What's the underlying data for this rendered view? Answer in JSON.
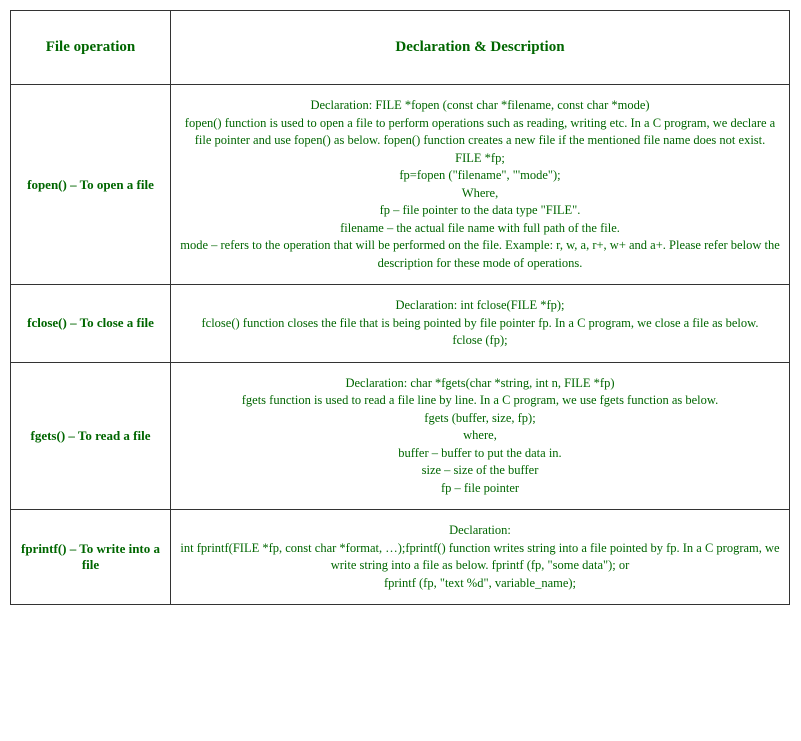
{
  "headers": {
    "col1": "File operation",
    "col2": "Declaration & Description"
  },
  "rows": [
    {
      "operation": "fopen() – To open a file",
      "lines": [
        "Declaration: FILE *fopen (const char *filename, const char *mode)",
        "fopen() function is used to open a file to perform operations such as reading, writing etc. In a C program, we declare a file pointer and use fopen() as below. fopen() function creates a new file if the mentioned file name does not exist.",
        "FILE *fp;",
        "fp=fopen (\"filename\", \"'mode\");",
        "Where,",
        "fp – file pointer to the data type \"FILE\".",
        "filename – the actual file name with full path of the file.",
        "mode – refers to the operation that will be performed on the file. Example: r, w, a, r+, w+ and a+. Please refer below the description for these mode of operations."
      ]
    },
    {
      "operation": "fclose() – To close a file",
      "lines": [
        "Declaration: int fclose(FILE *fp);",
        "fclose() function closes the file that is being pointed by file pointer fp. In a C program, we close a file as below.",
        "fclose (fp);"
      ]
    },
    {
      "operation": "fgets() – To read a file",
      "lines": [
        "Declaration: char *fgets(char *string, int n, FILE *fp)",
        "fgets function is used to read a file line by line. In a C program, we use fgets function as below.",
        "fgets (buffer, size, fp);",
        "where,",
        "buffer – buffer to put the data in.",
        "size – size of the buffer",
        "fp – file pointer"
      ]
    },
    {
      "operation": "fprintf() – To write into a file",
      "lines": [
        "Declaration:",
        "int fprintf(FILE *fp, const char *format, …);fprintf() function writes string into a file pointed by fp. In a C program, we write string into a file as below. fprintf (fp, \"some data\"); or",
        "fprintf (fp, \"text %d\", variable_name);"
      ]
    }
  ]
}
